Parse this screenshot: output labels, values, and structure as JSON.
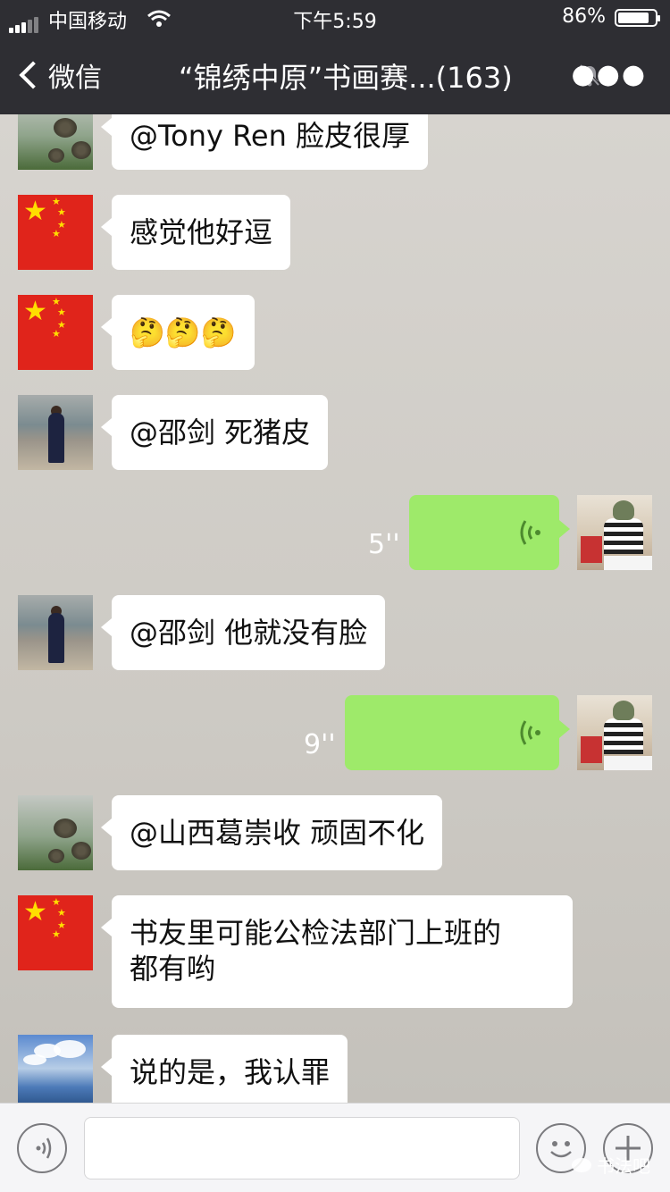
{
  "status_bar": {
    "carrier": "中国移动",
    "time": "下午5:59",
    "battery": "86%"
  },
  "nav": {
    "back_label": "微信",
    "title": "“锦绣中原”书画赛...(163)"
  },
  "messages": [
    {
      "side": "left",
      "avatar": "lotus-avatar",
      "text": "@Tony Ren 脸皮很厚"
    },
    {
      "side": "left",
      "avatar": "flag-avatar",
      "text": "感觉他好逗"
    },
    {
      "side": "left",
      "avatar": "flag-avatar",
      "text": "🤔🤔🤔"
    },
    {
      "side": "left",
      "avatar": "beach-avatar",
      "text": "@邵剑 死猪皮"
    },
    {
      "side": "right",
      "type": "voice",
      "duration": "5''"
    },
    {
      "side": "left",
      "avatar": "beach-avatar",
      "text": "@邵剑 他就没有脸"
    },
    {
      "side": "right",
      "type": "voice",
      "duration": "9''"
    },
    {
      "side": "left",
      "avatar": "lotus-avatar",
      "text": "@山西葛崇收 顽固不化"
    },
    {
      "side": "left",
      "avatar": "flag-avatar",
      "text_lines": [
        "书友里可能公检法部门上班的",
        "都有哟"
      ]
    },
    {
      "side": "left",
      "avatar": "sky-avatar",
      "text": "说的是，我认罪"
    }
  ],
  "watermark": "书法吧",
  "colors": {
    "header": "#2e2e33",
    "voice_bubble": "#9eea6a",
    "flag_red": "#e0241b"
  }
}
